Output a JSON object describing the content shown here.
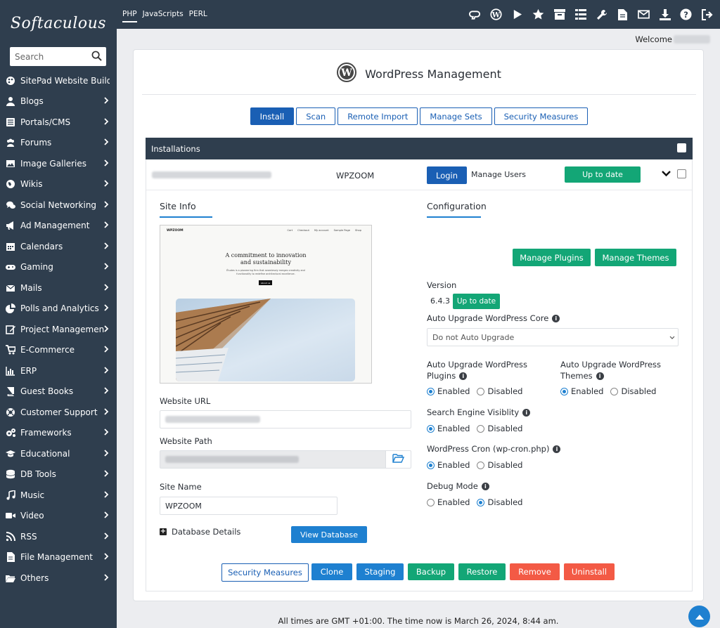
{
  "sidebar": {
    "logo": "Softaculous",
    "search_placeholder": "Search",
    "items": [
      {
        "label": "SitePad Website Builder",
        "icon": "sitepad-icon"
      },
      {
        "label": "Blogs",
        "icon": "user-icon"
      },
      {
        "label": "Portals/CMS",
        "icon": "list-icon"
      },
      {
        "label": "Forums",
        "icon": "users-icon"
      },
      {
        "label": "Image Galleries",
        "icon": "image-icon"
      },
      {
        "label": "Wikis",
        "icon": "globe-icon"
      },
      {
        "label": "Social Networking",
        "icon": "comments-icon"
      },
      {
        "label": "Ad Management",
        "icon": "bullhorn-icon"
      },
      {
        "label": "Calendars",
        "icon": "calendar-icon"
      },
      {
        "label": "Gaming",
        "icon": "gamepad-icon"
      },
      {
        "label": "Mails",
        "icon": "envelope-icon"
      },
      {
        "label": "Polls and Analytics",
        "icon": "pie-chart-icon"
      },
      {
        "label": "Project Management",
        "icon": "edit-icon"
      },
      {
        "label": "E-Commerce",
        "icon": "cart-icon"
      },
      {
        "label": "ERP",
        "icon": "bar-chart-icon"
      },
      {
        "label": "Guest Books",
        "icon": "book-icon"
      },
      {
        "label": "Customer Support",
        "icon": "lifebuoy-icon"
      },
      {
        "label": "Frameworks",
        "icon": "cogs-icon"
      },
      {
        "label": "Educational",
        "icon": "graduation-cap-icon"
      },
      {
        "label": "DB Tools",
        "icon": "database-icon"
      },
      {
        "label": "Music",
        "icon": "music-icon"
      },
      {
        "label": "Video",
        "icon": "video-icon"
      },
      {
        "label": "RSS",
        "icon": "rss-icon"
      },
      {
        "label": "File Management",
        "icon": "file-icon"
      },
      {
        "label": "Others",
        "icon": "folder-icon"
      }
    ]
  },
  "topbar": {
    "tabs": [
      "PHP",
      "JavaScripts",
      "PERL"
    ],
    "active_tab": "PHP",
    "icons": [
      "cpanel-icon",
      "wordpress-icon",
      "play-icon",
      "star-icon",
      "archive-icon",
      "list-icon",
      "wrench-icon",
      "file-icon",
      "envelope-icon",
      "download-icon",
      "help-icon",
      "logout-icon"
    ]
  },
  "welcome": {
    "label": "Welcome"
  },
  "page": {
    "title": "WordPress Management",
    "tabs": [
      {
        "label": "Install",
        "active": true
      },
      {
        "label": "Scan",
        "active": false
      },
      {
        "label": "Remote Import",
        "active": false
      },
      {
        "label": "Manage Sets",
        "active": false
      },
      {
        "label": "Security Measures",
        "active": false
      }
    ],
    "installations_header": "Installations"
  },
  "installation": {
    "theme_name": "WPZOOM",
    "login_label": "Login",
    "manage_users_label": "Manage Users",
    "status_label": "Up to date",
    "site_info_heading": "Site Info",
    "configuration_heading": "Configuration",
    "manage_plugins_label": "Manage Plugins",
    "manage_themes_label": "Manage Themes",
    "preview": {
      "brand": "WPZOOM",
      "nav": [
        "Cart",
        "Checkout",
        "My account",
        "Sample Page",
        "Shop"
      ],
      "headline_1": "A commitment to innovation",
      "headline_2": "and sustainability",
      "body_1": "Études is a pioneering firm that seamlessly merges creativity and",
      "body_2": "functionality to redefine architectural excellence.",
      "button": "About us"
    },
    "website_url_label": "Website URL",
    "website_path_label": "Website Path",
    "site_name_label": "Site Name",
    "site_name_value": "WPZOOM",
    "database_details_label": "Database Details",
    "view_database_label": "View Database",
    "version_label": "Version",
    "version_value": "6.4.3",
    "version_status": "Up to date",
    "auto_upgrade_core_label": "Auto Upgrade WordPress Core",
    "auto_upgrade_core_value": "Do not Auto Upgrade",
    "auto_upgrade_plugins_label_1": "Auto Upgrade WordPress",
    "auto_upgrade_plugins_label_2": "Plugins",
    "auto_upgrade_themes_label_1": "Auto Upgrade WordPress",
    "auto_upgrade_themes_label_2": "Themes",
    "search_engine_label": "Search Engine Visiblity",
    "cron_label": "WordPress Cron (wp-cron.php)",
    "debug_label": "Debug Mode",
    "enabled_label": "Enabled",
    "disabled_label": "Disabled",
    "settings": {
      "auto_upgrade_plugins": "Enabled",
      "auto_upgrade_themes": "Enabled",
      "search_engine": "Enabled",
      "cron": "Enabled",
      "debug": "Disabled"
    }
  },
  "actions": [
    {
      "label": "Security Measures",
      "style": "outline"
    },
    {
      "label": "Clone",
      "style": "blue"
    },
    {
      "label": "Staging",
      "style": "blue"
    },
    {
      "label": "Backup",
      "style": "green"
    },
    {
      "label": "Restore",
      "style": "green"
    },
    {
      "label": "Remove",
      "style": "red"
    },
    {
      "label": "Uninstall",
      "style": "red"
    }
  ],
  "footer": "All times are GMT +01:00. The time now is March 26, 2024, 8:44 am.",
  "colors": {
    "sidebar": "#2f3e4e",
    "primary": "#1a5fb4",
    "success": "#13a676",
    "danger": "#f35a45"
  }
}
